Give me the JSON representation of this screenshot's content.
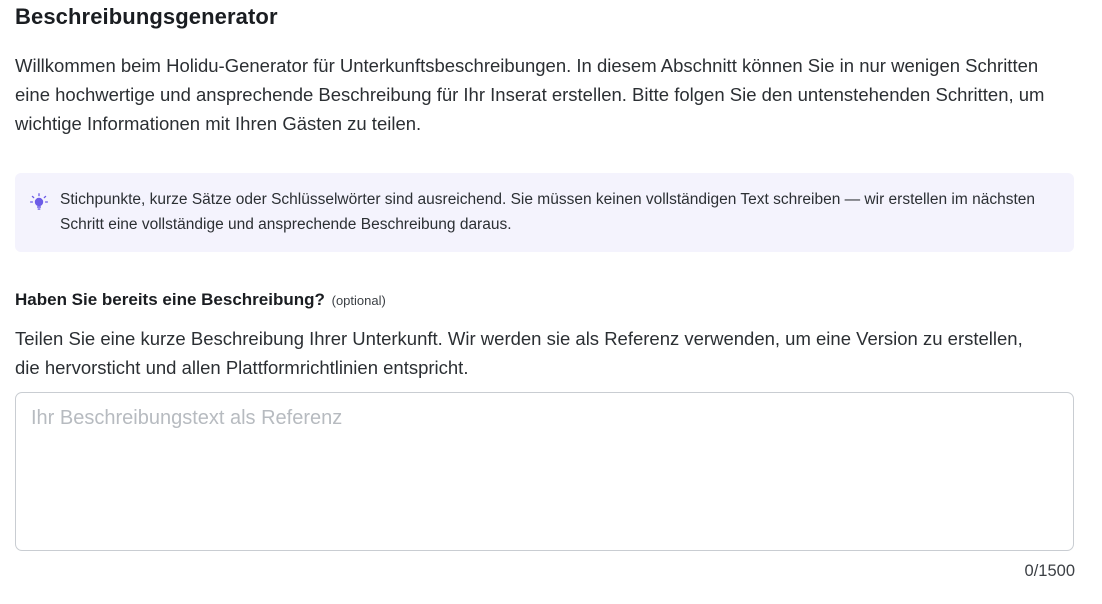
{
  "header": {
    "title": "Beschreibungsgenerator"
  },
  "intro": {
    "text": "Willkommen beim Holidu-Generator für Unterkunftsbeschreibungen. In diesem Abschnitt können Sie in nur wenigen Schritten eine hochwertige und ansprechende Beschreibung für Ihr Inserat erstellen. Bitte folgen Sie den untenstehenden Schritten, um wichtige Informationen mit Ihren Gästen zu teilen."
  },
  "tip": {
    "icon": "lightbulb-icon",
    "icon_color": "#6c5ce7",
    "background": "#f4f3fd",
    "text": "Stichpunkte, kurze Sätze oder Schlüsselwörter sind ausreichend. Sie müssen keinen vollständigen Text schreiben — wir erstellen im nächsten Schritt eine vollständige und ansprechende Beschreibung daraus."
  },
  "description_field": {
    "label": "Haben Sie bereits eine Beschreibung?",
    "optional_label": "(optional)",
    "help_text": "Teilen Sie eine kurze Beschreibung Ihrer Unterkunft. Wir werden sie als Referenz verwenden, um eine Version zu erstellen, die hervorsticht und allen Plattformrichtlinien entspricht.",
    "value": "",
    "placeholder": "Ihr Beschreibungstext als Referenz",
    "counter": "0/1500"
  }
}
